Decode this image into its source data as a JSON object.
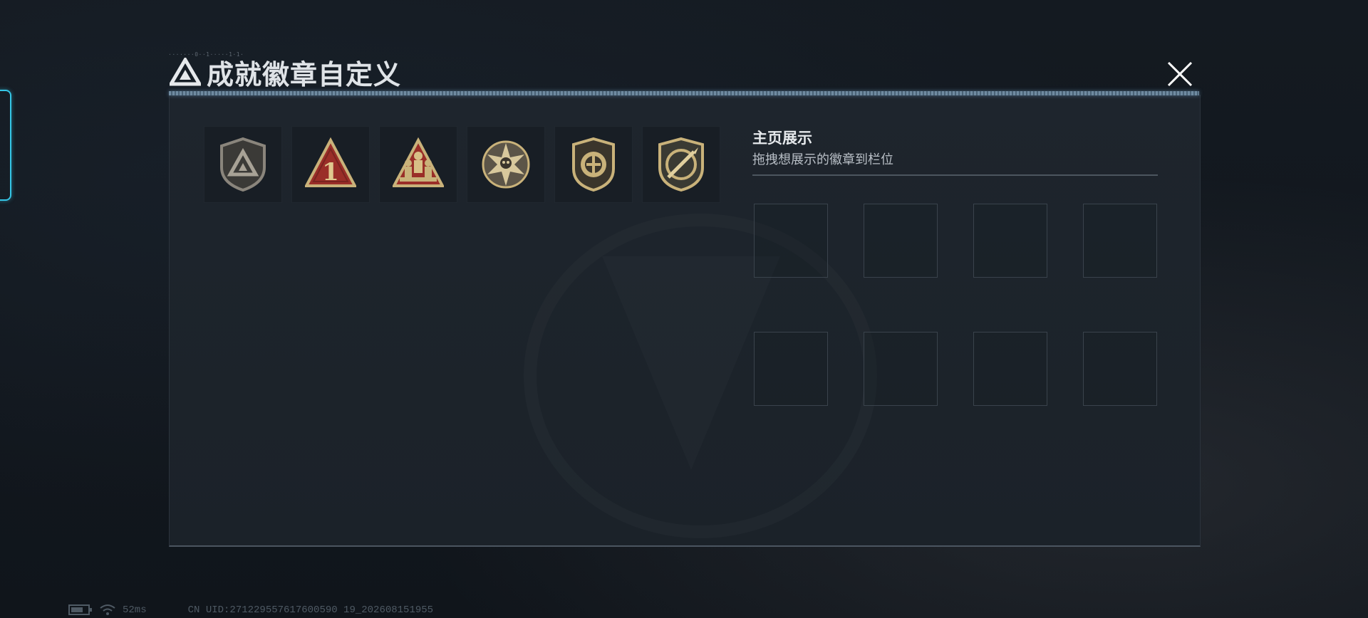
{
  "header": {
    "title": "成就徽章自定义",
    "tiny_caption": "·······0··1·····1·1·",
    "close_icon": "close-x-icon"
  },
  "badges": [
    {
      "name": "gray-triangle-shield-badge",
      "color": "#8a857c"
    },
    {
      "name": "red-triangle-number-one-badge",
      "number": "1",
      "color": "#9a2e28"
    },
    {
      "name": "red-triangle-soldiers-badge",
      "color": "#9a2e28"
    },
    {
      "name": "star-skull-medal-badge",
      "color": "#c9b27a"
    },
    {
      "name": "round-shield-emblem-badge",
      "color": "#c9b27a"
    },
    {
      "name": "shield-crossed-blade-badge",
      "color": "#c9b27a"
    }
  ],
  "display": {
    "heading": "主页展示",
    "hint": "拖拽想展示的徽章到栏位",
    "slot_count": 8
  },
  "status": {
    "ping": "52ms",
    "uid": "CN UID:271229557617600590 19_202608151955"
  },
  "colors": {
    "accent_cyan": "#35c6e6",
    "gold": "#c9b27a",
    "badge_red": "#9a2e28"
  }
}
